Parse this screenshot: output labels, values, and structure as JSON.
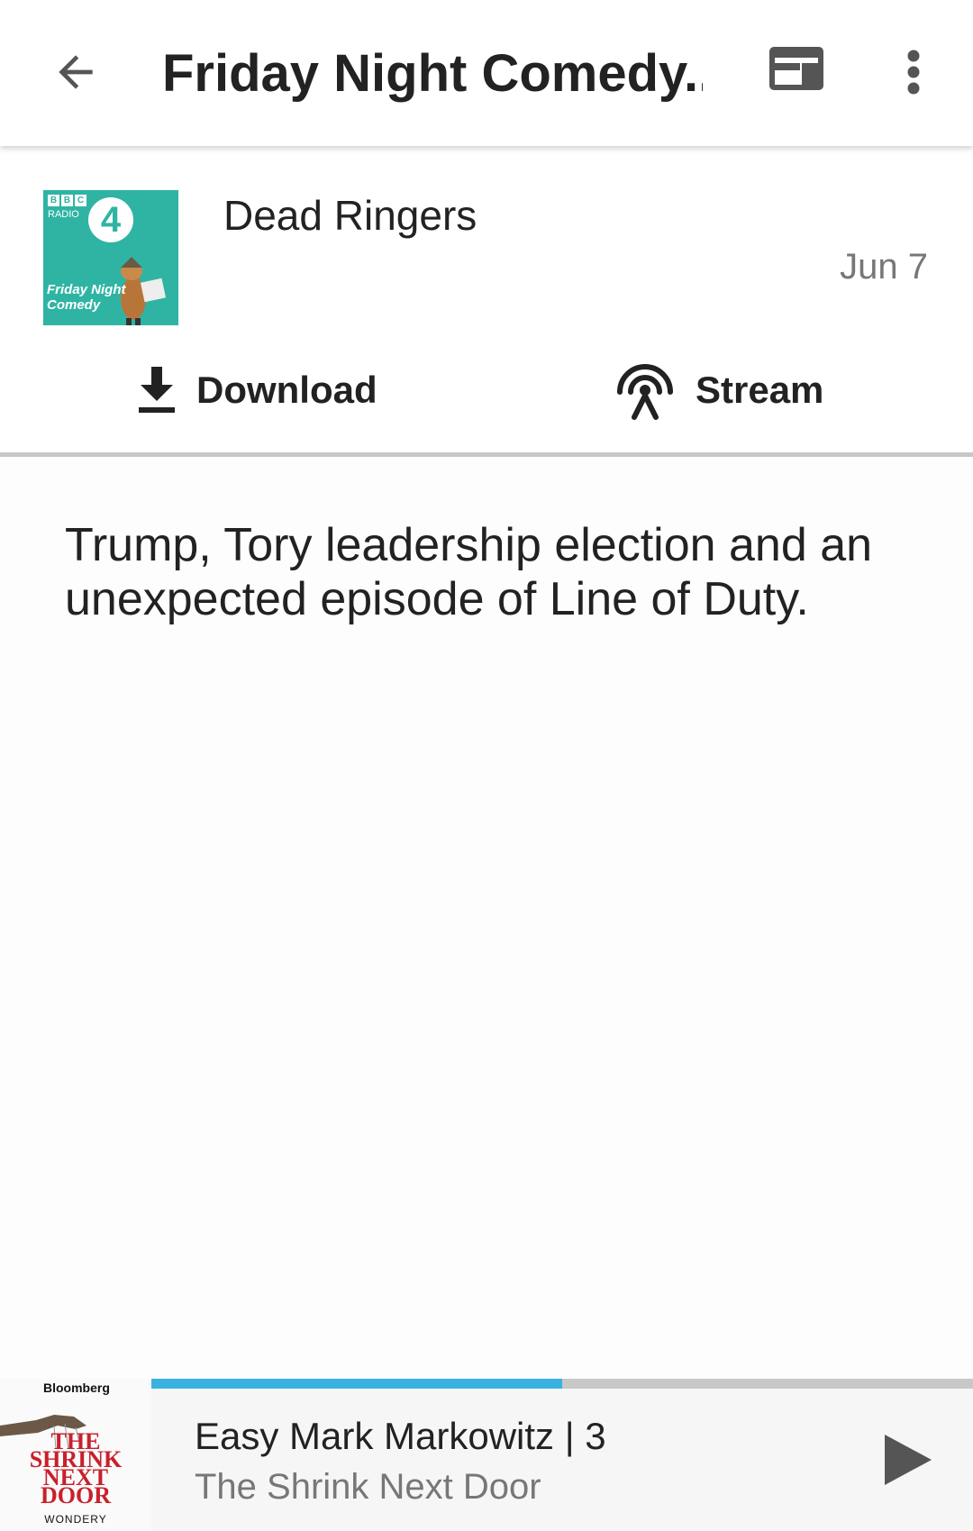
{
  "header": {
    "title": "Friday Night Comedy...",
    "back_icon": "arrow-back-icon",
    "web_icon": "web-view-icon",
    "more_icon": "more-vert-icon"
  },
  "episode": {
    "title": "Dead Ringers",
    "date": "Jun 7",
    "cover": {
      "bbc": [
        "B",
        "B",
        "C"
      ],
      "radio": "RADIO",
      "station": "4",
      "caption_line1": "Friday Night",
      "caption_line2": "Comedy"
    },
    "download_label": "Download",
    "stream_label": "Stream",
    "description": "Trump, Tory leadership election and an unexpected episode of Line of Duty."
  },
  "player": {
    "title": "Easy Mark Markowitz  | 3",
    "show": "The Shrink Next Door",
    "progress": 0.5,
    "art": {
      "brand": "Bloomberg",
      "line1": "THE",
      "line2": "SHRINK",
      "line3": "NEXT",
      "line4": "DOOR",
      "publisher": "WONDERY"
    },
    "play_icon": "play-icon"
  },
  "colors": {
    "accent": "#3ab2e0",
    "cover_bg": "#2fb4a4",
    "art_red": "#c8202c"
  }
}
